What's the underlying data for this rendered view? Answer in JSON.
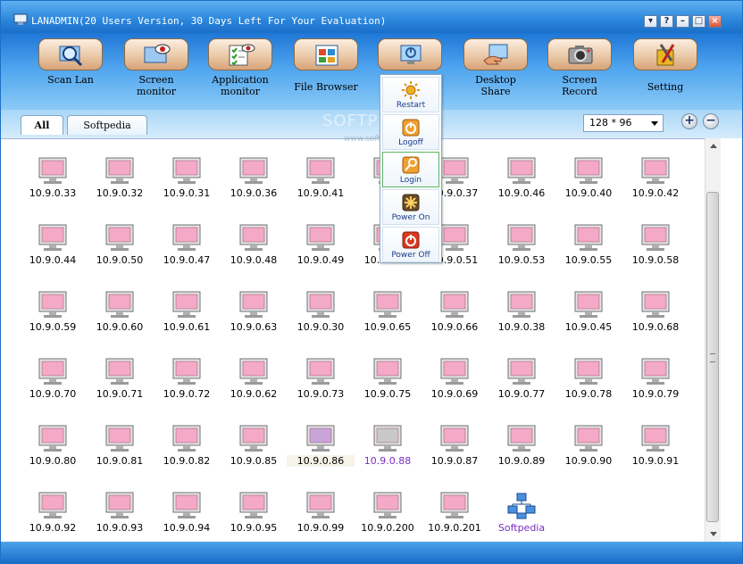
{
  "window": {
    "title": "LANADMIN(20 Users Version, 30 Days Left For Your Evaluation)",
    "controls": [
      "▾",
      "?",
      "–",
      "□",
      "×"
    ]
  },
  "toolbar": {
    "buttons": [
      {
        "label": "Scan Lan",
        "icon": "magnifier-icon"
      },
      {
        "label": "Screen\nmonitor",
        "icon": "eye-screen-icon"
      },
      {
        "label": "Application\nmonitor",
        "icon": "checklist-icon"
      },
      {
        "label": "File Browser",
        "icon": "file-grid-icon"
      },
      {
        "label": "",
        "icon": "power-monitor-icon"
      },
      {
        "label": "Desktop\nShare",
        "icon": "hand-desktop-icon"
      },
      {
        "label": "Screen\nRecord",
        "icon": "camera-icon"
      },
      {
        "label": "Setting",
        "icon": "tools-icon"
      }
    ]
  },
  "power_menu": {
    "items": [
      {
        "label": "Restart",
        "icon": "sun-restart-icon"
      },
      {
        "label": "Logoff",
        "icon": "logoff-icon"
      },
      {
        "label": "Login",
        "icon": "key-login-icon"
      },
      {
        "label": "Power On",
        "icon": "power-on-icon"
      },
      {
        "label": "Power Off",
        "icon": "power-off-icon"
      }
    ]
  },
  "tabs": [
    {
      "label": "All",
      "active": true
    },
    {
      "label": "Softpedia",
      "active": false
    }
  ],
  "size_select": {
    "value": "128 * 96"
  },
  "zoom": {
    "plus": "+",
    "minus": "−"
  },
  "watermark": {
    "text": "SOFTPEDIA",
    "sub": "www.softpedia.com"
  },
  "hosts": [
    [
      "10.9.0.33",
      "10.9.0.32",
      "10.9.0.31",
      "10.9.0.36",
      "10.9.0.41",
      "",
      "10.9.0.37",
      "10.9.0.46",
      "10.9.0.40",
      "10.9.0.42"
    ],
    [
      "10.9.0.44",
      "10.9.0.50",
      "10.9.0.47",
      "10.9.0.48",
      "10.9.0.49",
      "10.9.0.52",
      "10.9.0.51",
      "10.9.0.53",
      "10.9.0.55",
      "10.9.0.58"
    ],
    [
      "10.9.0.59",
      "10.9.0.60",
      "10.9.0.61",
      "10.9.0.63",
      "10.9.0.30",
      "10.9.0.65",
      "10.9.0.66",
      "10.9.0.38",
      "10.9.0.45",
      "10.9.0.68"
    ],
    [
      "10.9.0.70",
      "10.9.0.71",
      "10.9.0.72",
      "10.9.0.62",
      "10.9.0.73",
      "10.9.0.75",
      "10.9.0.69",
      "10.9.0.77",
      "10.9.0.78",
      "10.9.0.79"
    ],
    [
      "10.9.0.80",
      "10.9.0.81",
      "10.9.0.82",
      "10.9.0.85",
      "10.9.0.86",
      "10.9.0.88",
      "10.9.0.87",
      "10.9.0.89",
      "10.9.0.90",
      "10.9.0.91"
    ],
    [
      "10.9.0.92",
      "10.9.0.93",
      "10.9.0.94",
      "10.9.0.95",
      "10.9.0.99",
      "10.9.0.200",
      "10.9.0.201",
      "Softpedia"
    ]
  ],
  "colors": {
    "screen_on": "#f4a9c6",
    "screen_off": "#c8c8c8",
    "screen_selected": "#c8a4d8",
    "group_label": "#7a2ec4"
  }
}
